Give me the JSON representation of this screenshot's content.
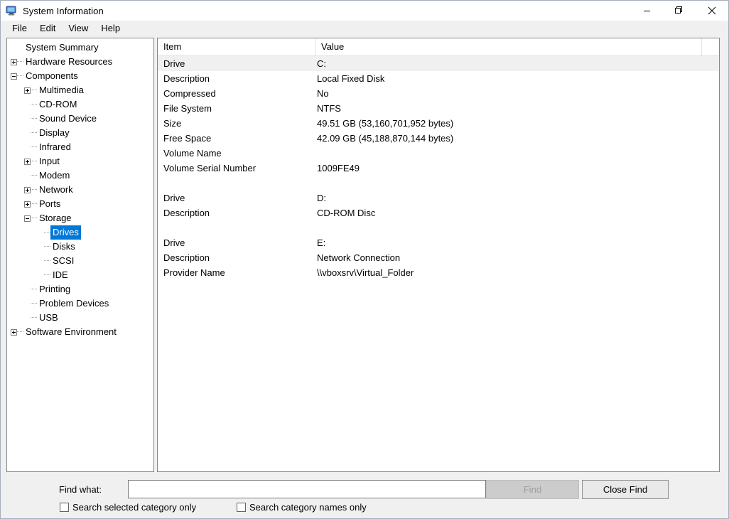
{
  "window": {
    "title": "System Information",
    "icon": "computer-monitor-icon",
    "accent_color": "#0078d7",
    "titlebar_bg": "#ffffff",
    "controls": {
      "minimize": "minimize-icon",
      "restore": "restore-icon",
      "close": "close-icon"
    }
  },
  "menubar": {
    "items": [
      {
        "label": "File"
      },
      {
        "label": "Edit"
      },
      {
        "label": "View"
      },
      {
        "label": "Help"
      }
    ]
  },
  "tree": {
    "nodes": [
      {
        "label": "System Summary",
        "depth": 0,
        "twist": "none",
        "selected": false
      },
      {
        "label": "Hardware Resources",
        "depth": 0,
        "twist": "plus",
        "selected": false
      },
      {
        "label": "Components",
        "depth": 0,
        "twist": "minus",
        "selected": false
      },
      {
        "label": "Multimedia",
        "depth": 1,
        "twist": "plus",
        "selected": false
      },
      {
        "label": "CD-ROM",
        "depth": 1,
        "twist": "leaf",
        "selected": false
      },
      {
        "label": "Sound Device",
        "depth": 1,
        "twist": "leaf",
        "selected": false
      },
      {
        "label": "Display",
        "depth": 1,
        "twist": "leaf",
        "selected": false
      },
      {
        "label": "Infrared",
        "depth": 1,
        "twist": "leaf",
        "selected": false
      },
      {
        "label": "Input",
        "depth": 1,
        "twist": "plus",
        "selected": false
      },
      {
        "label": "Modem",
        "depth": 1,
        "twist": "leaf",
        "selected": false
      },
      {
        "label": "Network",
        "depth": 1,
        "twist": "plus",
        "selected": false
      },
      {
        "label": "Ports",
        "depth": 1,
        "twist": "plus",
        "selected": false
      },
      {
        "label": "Storage",
        "depth": 1,
        "twist": "minus",
        "selected": false
      },
      {
        "label": "Drives",
        "depth": 2,
        "twist": "leaf",
        "selected": true
      },
      {
        "label": "Disks",
        "depth": 2,
        "twist": "leaf",
        "selected": false
      },
      {
        "label": "SCSI",
        "depth": 2,
        "twist": "leaf",
        "selected": false
      },
      {
        "label": "IDE",
        "depth": 2,
        "twist": "leaf",
        "selected": false
      },
      {
        "label": "Printing",
        "depth": 1,
        "twist": "leaf",
        "selected": false
      },
      {
        "label": "Problem Devices",
        "depth": 1,
        "twist": "leaf",
        "selected": false
      },
      {
        "label": "USB",
        "depth": 1,
        "twist": "leaf",
        "selected": false
      },
      {
        "label": "Software Environment",
        "depth": 0,
        "twist": "plus",
        "selected": false
      }
    ]
  },
  "list": {
    "columns": [
      {
        "label": "Item"
      },
      {
        "label": "Value"
      }
    ],
    "rows": [
      {
        "item": "Drive",
        "value": "C:",
        "alt": true
      },
      {
        "item": "Description",
        "value": "Local Fixed Disk",
        "alt": false
      },
      {
        "item": "Compressed",
        "value": "No",
        "alt": false
      },
      {
        "item": "File System",
        "value": "NTFS",
        "alt": false
      },
      {
        "item": "Size",
        "value": "49.51 GB (53,160,701,952 bytes)",
        "alt": false
      },
      {
        "item": "Free Space",
        "value": "42.09 GB (45,188,870,144 bytes)",
        "alt": false
      },
      {
        "item": "Volume Name",
        "value": "",
        "alt": false
      },
      {
        "item": "Volume Serial Number",
        "value": "1009FE49",
        "alt": false
      },
      {
        "item": "",
        "value": "",
        "alt": false
      },
      {
        "item": "Drive",
        "value": "D:",
        "alt": false
      },
      {
        "item": "Description",
        "value": "CD-ROM Disc",
        "alt": false
      },
      {
        "item": "",
        "value": "",
        "alt": false
      },
      {
        "item": "Drive",
        "value": "E:",
        "alt": false
      },
      {
        "item": "Description",
        "value": "Network Connection",
        "alt": false
      },
      {
        "item": "Provider Name",
        "value": "\\\\vboxsrv\\Virtual_Folder",
        "alt": false
      }
    ]
  },
  "findbar": {
    "label": "Find what:",
    "input_value": "",
    "input_placeholder": "",
    "find_button": "Find",
    "find_button_disabled": true,
    "close_find_button": "Close Find",
    "checkbox_selected_category": {
      "label": "Search selected category only",
      "checked": false
    },
    "checkbox_category_names": {
      "label": "Search category names only",
      "checked": false
    }
  }
}
